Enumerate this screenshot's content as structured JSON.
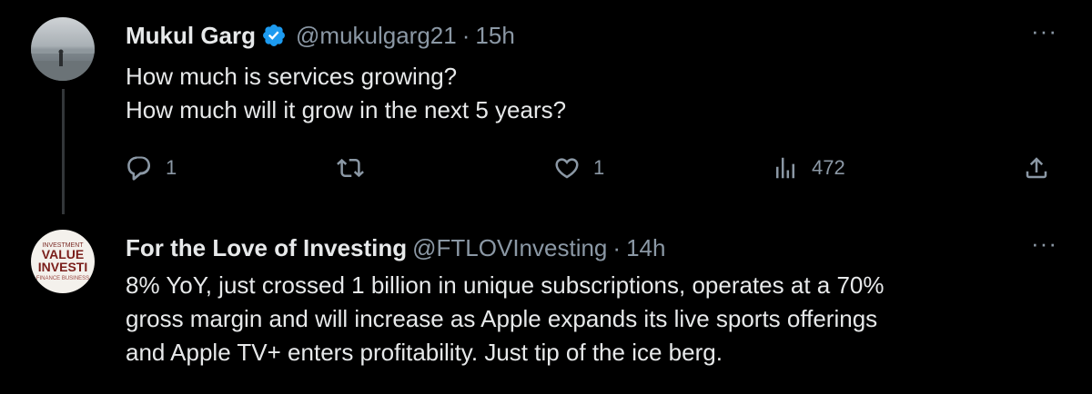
{
  "tweets": [
    {
      "name": "Mukul Garg",
      "handle": "@mukulgarg21",
      "separator": "·",
      "time": "15h",
      "more": "···",
      "lines": [
        "How much is services growing?",
        "How much will it grow in the next 5 years?"
      ],
      "actions": {
        "replies": "1",
        "retweets": "",
        "likes": "1",
        "views": "472"
      },
      "icons": [
        "reply-icon",
        "retweet-icon",
        "like-icon",
        "views-icon",
        "share-icon"
      ]
    },
    {
      "name": "For the Love of Investing",
      "handle": "@FTLOVInvesting",
      "separator": "·",
      "time": "14h",
      "more": "···",
      "avatar_text": {
        "top": "INVESTMENT",
        "line1": "VALUE",
        "line2": "INVESTI",
        "bottom": "FINANCE BUSINESS"
      },
      "lines": [
        "8% YoY, just crossed 1 billion in unique subscriptions, operates at a 70%",
        "gross margin and will increase as Apple expands its live sports offerings",
        "and Apple TV+ enters profitability. Just tip of the ice berg."
      ]
    }
  ],
  "colors": {
    "background": "#000000",
    "text": "#e7e9ea",
    "muted": "#8b98a5",
    "verified": "#1d9bf0",
    "thread_line": "#333639"
  }
}
